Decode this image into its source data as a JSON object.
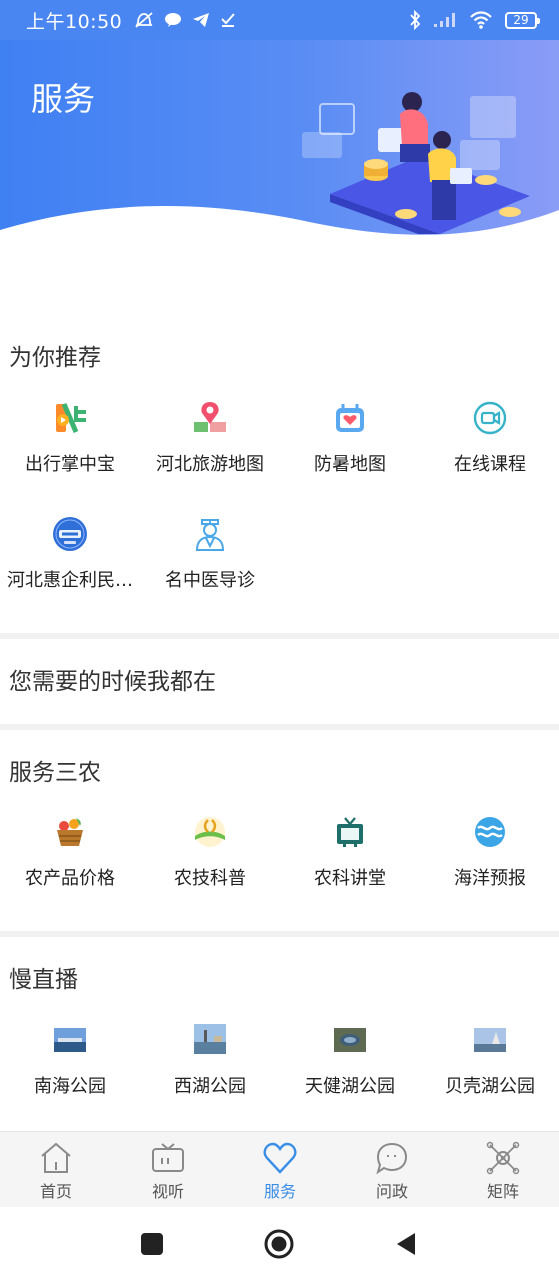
{
  "status_bar": {
    "time": "上午10:50",
    "battery": "29"
  },
  "header": {
    "title": "服务"
  },
  "sections": {
    "recommend": {
      "title": "为你推荐",
      "items": [
        {
          "label": "出行掌中宝",
          "icon": "travel-app-icon"
        },
        {
          "label": "河北旅游地图",
          "icon": "tourism-map-icon"
        },
        {
          "label": "防暑地图",
          "icon": "heat-prevention-map-icon"
        },
        {
          "label": "在线课程",
          "icon": "online-course-icon"
        },
        {
          "label": "河北惠企利民…",
          "icon": "enterprise-benefit-icon"
        },
        {
          "label": "名中医导诊",
          "icon": "doctor-icon"
        }
      ]
    },
    "always": {
      "title": "您需要的时候我都在"
    },
    "agriculture": {
      "title": "服务三农",
      "items": [
        {
          "label": "农产品价格",
          "icon": "produce-basket-icon"
        },
        {
          "label": "农技科普",
          "icon": "agri-tech-icon"
        },
        {
          "label": "农科讲堂",
          "icon": "tv-icon"
        },
        {
          "label": "海洋预报",
          "icon": "wave-icon"
        }
      ]
    },
    "live": {
      "title": "慢直播",
      "items": [
        {
          "label": "南海公园",
          "icon": "park-thumbnail"
        },
        {
          "label": "西湖公园",
          "icon": "park-thumbnail"
        },
        {
          "label": "天健湖公园",
          "icon": "park-thumbnail"
        },
        {
          "label": "贝壳湖公园",
          "icon": "park-thumbnail"
        }
      ]
    }
  },
  "tabs": [
    {
      "label": "首页",
      "icon": "home-icon"
    },
    {
      "label": "视听",
      "icon": "tv-icon"
    },
    {
      "label": "服务",
      "icon": "heart-icon",
      "active": true
    },
    {
      "label": "问政",
      "icon": "chat-bubble-icon"
    },
    {
      "label": "矩阵",
      "icon": "matrix-icon"
    }
  ],
  "colors": {
    "status_bar": "#4a86f1",
    "accent": "#3a8ee6",
    "divider": "#f1f1f1"
  }
}
